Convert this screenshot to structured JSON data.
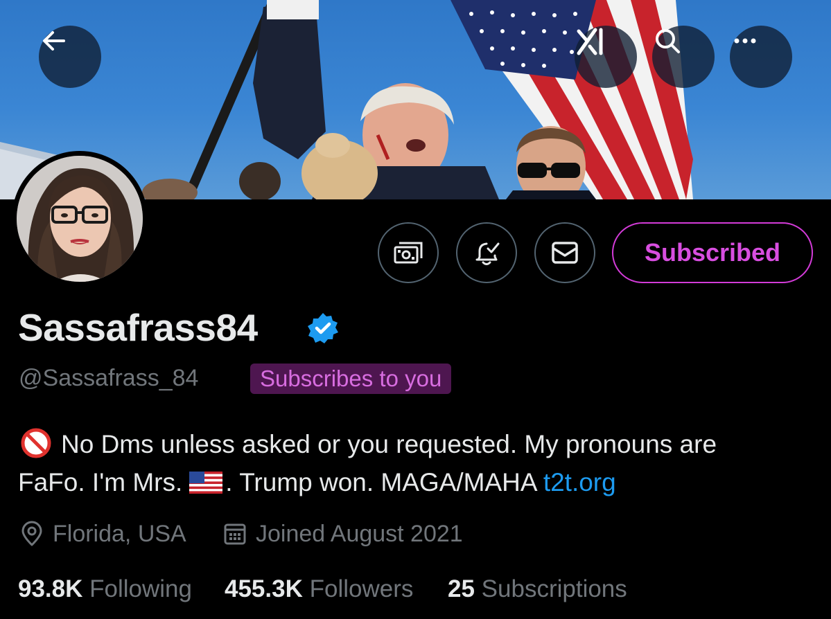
{
  "banner": {
    "description_icon": "banner-photo",
    "colors": {
      "sky": "#3b86d4"
    }
  },
  "top_actions": {
    "back_icon": "arrow-left-icon",
    "grok_icon": "grok-logo-icon",
    "search_icon": "search-icon",
    "more_icon": "more-horizontal-icon"
  },
  "profile": {
    "display_name": "Sassafrass84",
    "handle": "@Sassafrass_84",
    "subscribes_badge": "Subscribes to you",
    "bio": {
      "line1": "No Dms unless asked or you requested. My pronouns are",
      "line2_a": "FaFo. I'm Mrs.",
      "line2_b": ". Trump won. MAGA/MAHA",
      "link": "t2t.org"
    },
    "location": "Florida, USA",
    "joined": "Joined August 2021",
    "stats": {
      "following_count": "93.8K",
      "following_label": "Following",
      "followers_count": "455.3K",
      "followers_label": "Followers",
      "subscriptions_count": "25",
      "subscriptions_label": "Subscriptions"
    }
  },
  "actions": {
    "subscribed_label": "Subscribed",
    "tip_icon": "money-icon",
    "notify_icon": "bell-check-icon",
    "dm_icon": "envelope-icon"
  },
  "colors": {
    "accent_purple": "#d84ee0",
    "link_blue": "#1d9bf0",
    "muted": "#71767b",
    "text": "#e7e9ea",
    "verified": "#1d9bf0"
  }
}
